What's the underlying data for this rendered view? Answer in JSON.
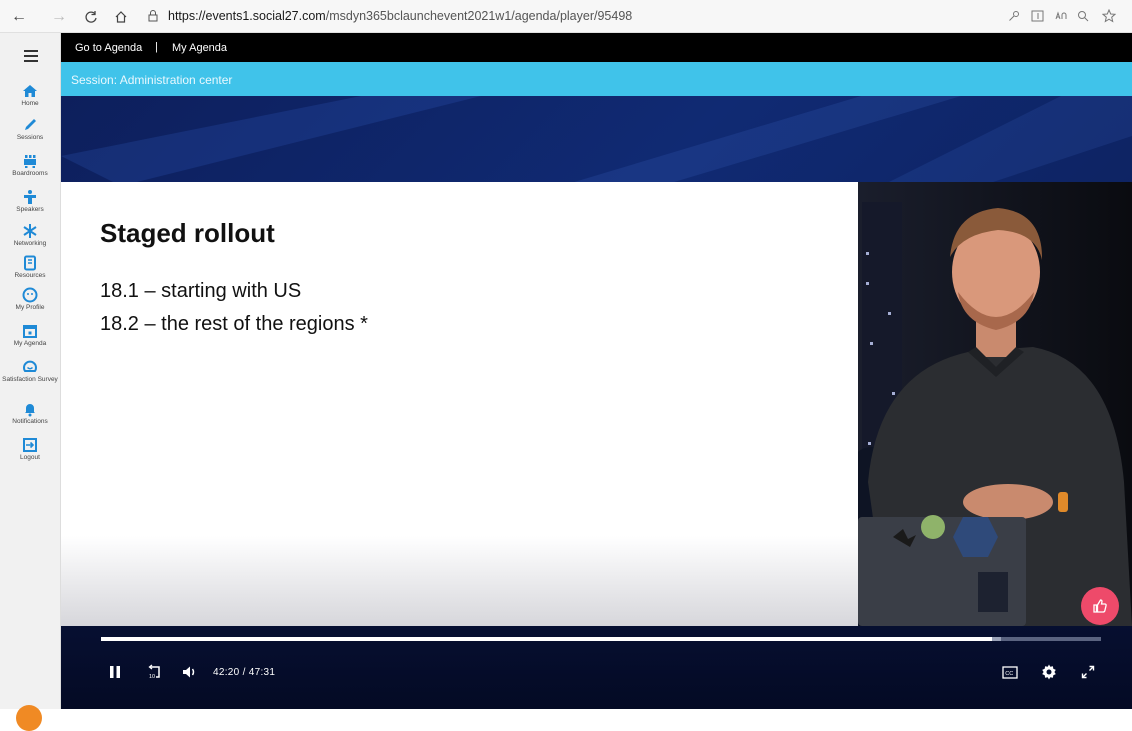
{
  "browser": {
    "url_host": "https://events1.social27.com",
    "url_path": "/msdyn365bclaunchevent2021w1/agenda/player/95498"
  },
  "sidebar": {
    "items": [
      {
        "label": "Home",
        "icon": "home-icon"
      },
      {
        "label": "Sessions",
        "icon": "pencil-icon"
      },
      {
        "label": "Boardrooms",
        "icon": "boardroom-icon"
      },
      {
        "label": "Speakers",
        "icon": "speaker-icon"
      },
      {
        "label": "Networking",
        "icon": "networking-icon"
      },
      {
        "label": "Resources",
        "icon": "resources-icon"
      },
      {
        "label": "My Profile",
        "icon": "profile-icon"
      },
      {
        "label": "My Agenda",
        "icon": "calendar-icon"
      },
      {
        "label": "Satisfaction Survey",
        "icon": "survey-icon"
      },
      {
        "label": "Notifications",
        "icon": "bell-icon"
      },
      {
        "label": "Logout",
        "icon": "logout-icon"
      }
    ]
  },
  "topnav": {
    "go_to_agenda": "Go to Agenda",
    "separator": "|",
    "my_agenda": "My Agenda"
  },
  "session": {
    "title": "Session: Administration center"
  },
  "slide": {
    "title": "Staged rollout",
    "lines": [
      "18.1 – starting with US",
      "18.2 – the rest of the regions *"
    ]
  },
  "player": {
    "time": "42:20 / 47:31",
    "progress": 0.891,
    "buffered": 0.9
  },
  "colors": {
    "accent": "#40c3ea",
    "icon_blue": "#1f8ad6",
    "like": "#ee4a6a"
  }
}
